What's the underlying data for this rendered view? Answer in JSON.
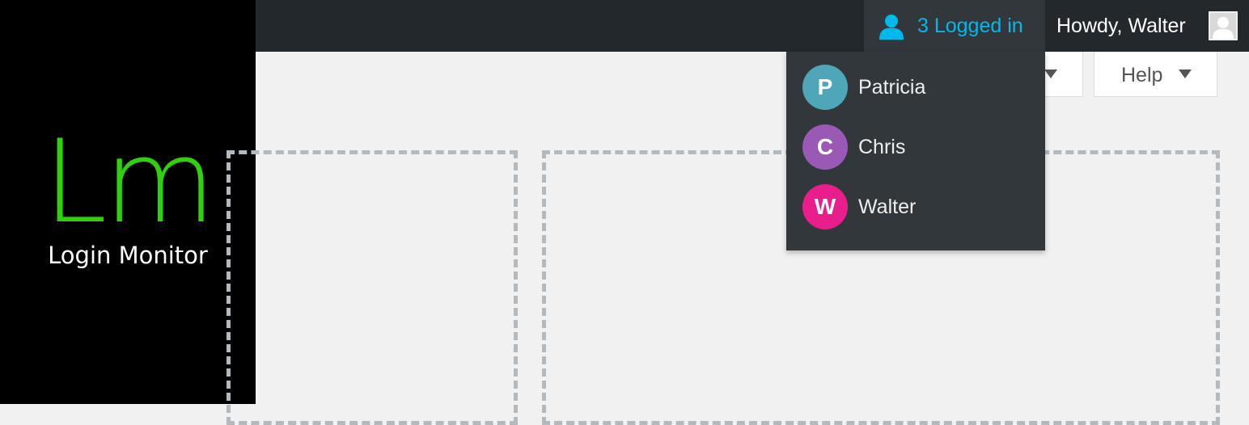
{
  "brand": {
    "logo": "Lm",
    "name": "Login Monitor",
    "logo_color": "#2fd10a"
  },
  "adminbar": {
    "logged_in_label": "3 Logged in",
    "logged_in_color": "#00b9eb",
    "howdy": "Howdy, Walter",
    "user_icon": "person-icon",
    "avatar_icon": "default-avatar-icon"
  },
  "screen_meta": {
    "help_label": "Help"
  },
  "logged_users": [
    {
      "initial": "P",
      "name": "Patricia",
      "color": "#4fa6b9"
    },
    {
      "initial": "C",
      "name": "Chris",
      "color": "#9b59b6"
    },
    {
      "initial": "W",
      "name": "Walter",
      "color": "#e91e8c"
    }
  ]
}
